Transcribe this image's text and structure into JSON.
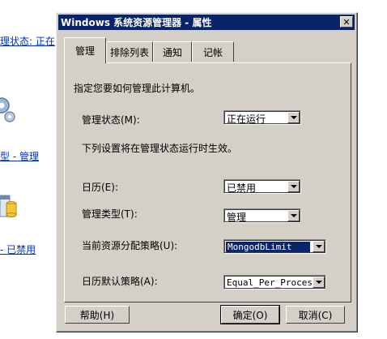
{
  "background": {
    "links": [
      "理状态: 正在",
      "型 - 管理",
      "- 已禁用"
    ],
    "icons": [
      "gear-icon",
      "database-icon"
    ]
  },
  "dialog": {
    "title": "Windows 系统资源管理器 - 属性",
    "close_label": "✕",
    "tabs": [
      {
        "label": "管理",
        "active": true
      },
      {
        "label": "排除列表",
        "active": false
      },
      {
        "label": "通知",
        "active": false
      },
      {
        "label": "记帐",
        "active": false
      }
    ],
    "panel": {
      "intro": "指定您要如何管理此计算机。",
      "management_status_label": "管理状态(M):",
      "management_status_value": "正在运行",
      "note": "下列设置将在管理状态运行时生效。",
      "calendar_label": "日历(E):",
      "calendar_value": "已禁用",
      "management_type_label": "管理类型(T):",
      "management_type_value": "管理",
      "current_policy_label": "当前资源分配策略(U):",
      "current_policy_value": "MongodbLimit",
      "calendar_default_label": "日历默认策略(A):",
      "calendar_default_value": "Equal_Per_Process"
    },
    "buttons": {
      "help": "帮助(H)",
      "ok": "确定(O)",
      "cancel": "取消(C)"
    }
  }
}
